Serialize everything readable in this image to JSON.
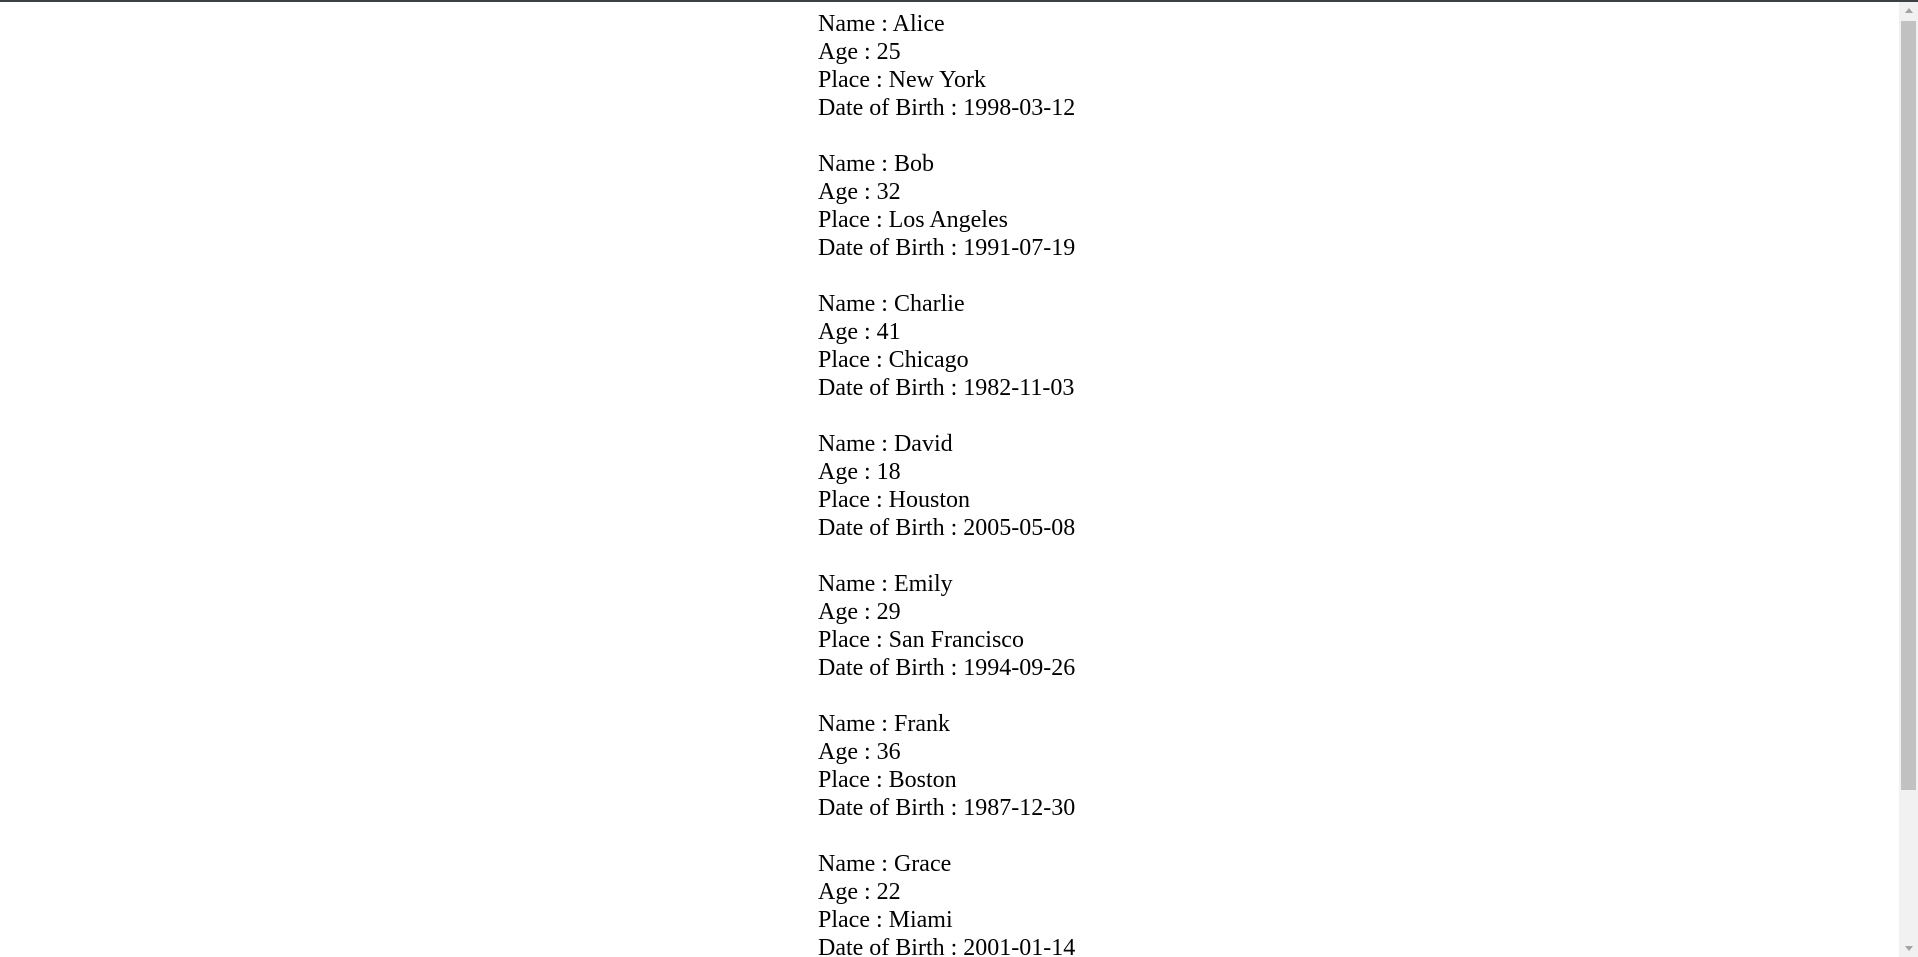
{
  "people": [
    {
      "name_line": "Name : Alice",
      "age_line": "Age : 25",
      "place_line": "Place : New York",
      "dob_line": "Date of Birth : 1998-03-12"
    },
    {
      "name_line": "Name : Bob",
      "age_line": "Age : 32",
      "place_line": "Place : Los Angeles",
      "dob_line": "Date of Birth : 1991-07-19"
    },
    {
      "name_line": "Name : Charlie",
      "age_line": "Age : 41",
      "place_line": "Place : Chicago",
      "dob_line": "Date of Birth : 1982-11-03"
    },
    {
      "name_line": "Name : David",
      "age_line": "Age : 18",
      "place_line": "Place : Houston",
      "dob_line": "Date of Birth : 2005-05-08"
    },
    {
      "name_line": "Name : Emily",
      "age_line": "Age : 29",
      "place_line": "Place : San Francisco",
      "dob_line": "Date of Birth : 1994-09-26"
    },
    {
      "name_line": "Name : Frank",
      "age_line": "Age : 36",
      "place_line": "Place : Boston",
      "dob_line": "Date of Birth : 1987-12-30"
    },
    {
      "name_line": "Name : Grace",
      "age_line": "Age : 22",
      "place_line": "Place : Miami",
      "dob_line": "Date of Birth : 2001-01-14"
    }
  ],
  "scrollbar": {
    "up_icon": "arrow-up-icon",
    "down_icon": "arrow-down-icon"
  },
  "colors": {
    "background": "#ffffff",
    "text": "#000000",
    "scroll_track": "#f1f1f1",
    "scroll_thumb": "#c1c1c1"
  }
}
